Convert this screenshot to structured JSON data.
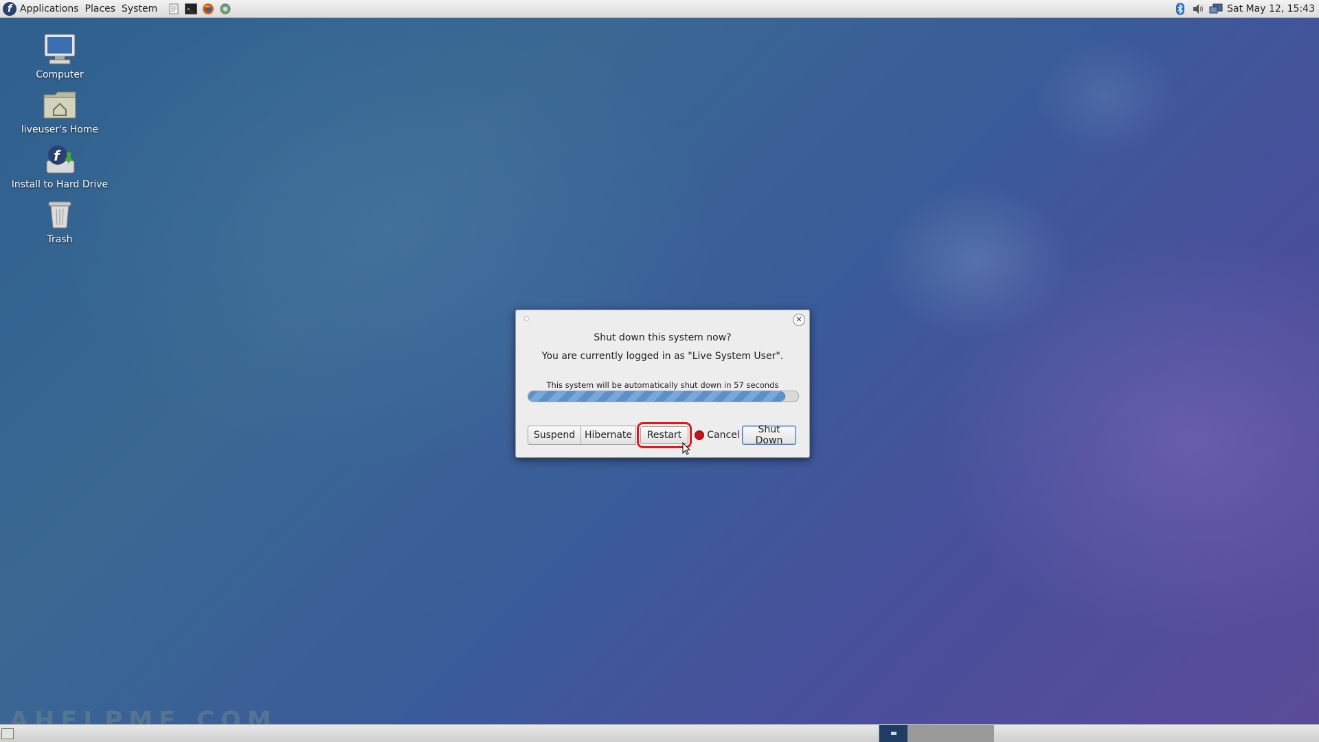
{
  "top_panel": {
    "menus": [
      "Applications",
      "Places",
      "System"
    ],
    "launchers": [
      "text-editor-icon",
      "terminal-icon",
      "firefox-icon",
      "network-icon"
    ],
    "tray": [
      "bluetooth-icon",
      "volume-icon",
      "network-status-icon"
    ],
    "clock": "Sat May 12, 15:43"
  },
  "desktop_icons": [
    {
      "label": "Computer",
      "icon": "computer-icon"
    },
    {
      "label": "liveuser's Home",
      "icon": "home-folder-icon"
    },
    {
      "label": "Install to Hard Drive",
      "icon": "install-icon"
    },
    {
      "label": "Trash",
      "icon": "trash-icon"
    }
  ],
  "dialog": {
    "title": "Shut down this system now?",
    "subtitle": "You are currently logged in as \"Live System User\".",
    "countdown": "This system will be automatically shut down in 57 seconds",
    "progress_fraction": 0.95,
    "buttons": {
      "suspend": "Suspend",
      "hibernate": "Hibernate",
      "restart": "Restart",
      "cancel": "Cancel",
      "shutdown": "Shut Down"
    }
  },
  "bottom_panel": {
    "workspaces": 4,
    "active_workspace": 1
  },
  "watermark": "AHELPME.COM",
  "colors": {
    "highlight": "#e8141b",
    "progress": "#5d8fcb",
    "cancel_dot": "#c5141a"
  }
}
